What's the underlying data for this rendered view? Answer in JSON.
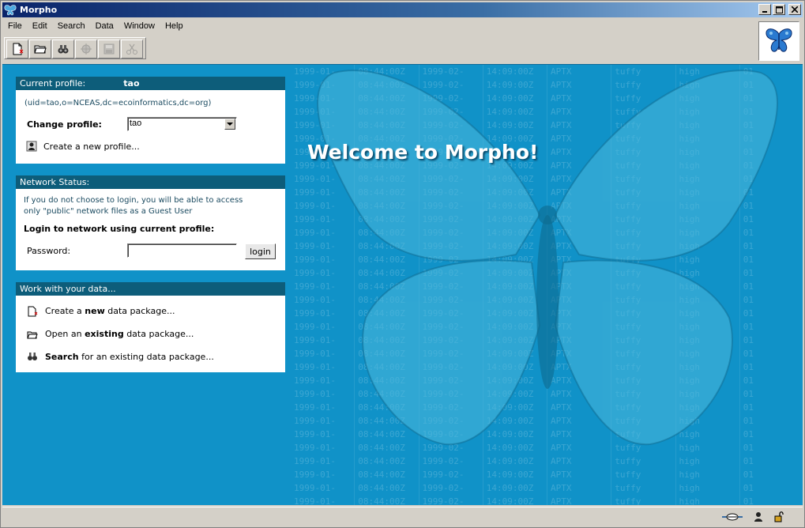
{
  "window": {
    "title": "Morpho"
  },
  "menu": [
    "File",
    "Edit",
    "Search",
    "Data",
    "Window",
    "Help"
  ],
  "toolbar": {
    "buttons": [
      "new-package",
      "open-package",
      "search",
      "network",
      "save",
      "cut"
    ]
  },
  "profile_panel": {
    "header_label": "Current profile:",
    "profile_name": "tao",
    "dn": "(uid=tao,o=NCEAS,dc=ecoinformatics,dc=org)",
    "change_label": "Change profile:",
    "selected": "tao",
    "create_link": "Create a new profile..."
  },
  "network_panel": {
    "header": "Network Status:",
    "info_line1": "If you do not choose to login, you will be able to access",
    "info_line2": "only \"public\" network files as a Guest User",
    "login_heading": "Login to network using current profile:",
    "password_label": "Password:",
    "password_value": "",
    "login_button": "login"
  },
  "data_panel": {
    "header": "Work with your data...",
    "create_prefix": "Create a ",
    "create_bold": "new",
    "create_suffix": " data package...",
    "open_prefix": "Open an ",
    "open_bold": "existing",
    "open_suffix": " data package...",
    "search_bold": "Search",
    "search_suffix": " for an existing data package..."
  },
  "welcome": "Welcome to Morpho!",
  "colors": {
    "main_bg": "#1092c8",
    "panel_header": "#0d5d7a"
  }
}
